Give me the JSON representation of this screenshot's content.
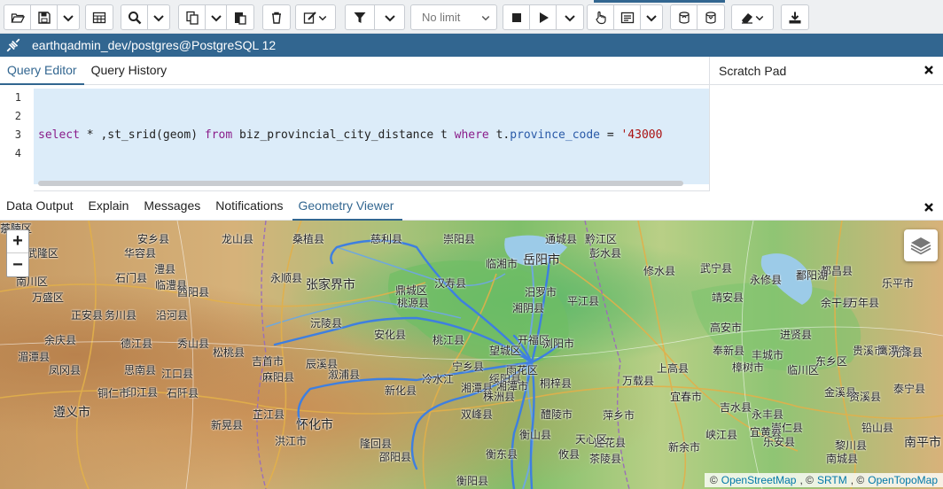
{
  "toolbar": {
    "limit_select": "No limit",
    "icons": [
      "folder-open-icon",
      "save-icon",
      "chevron-down-icon",
      "grid-icon",
      "search-icon",
      "chevron-down-icon",
      "copy-icon",
      "paste-icon",
      "delete-icon",
      "edit-icon",
      "chevron-down-icon",
      "filter-icon",
      "chevron-down-icon",
      "stop-icon",
      "play-icon",
      "chevron-down-icon",
      "hand-icon",
      "explain-icon",
      "chevron-down-icon",
      "commit-icon",
      "rollback-icon",
      "eraser-icon",
      "chevron-down-icon",
      "download-icon"
    ]
  },
  "connection": {
    "label": "earthqadmin_dev/postgres@PostgreSQL 12"
  },
  "editor_tabs": {
    "query_editor": "Query Editor",
    "query_history": "Query History"
  },
  "scratch_pad": {
    "title": "Scratch Pad"
  },
  "editor": {
    "line_numbers": [
      "1",
      "2",
      "3",
      "4"
    ],
    "line3": {
      "kw_select": "select",
      "part1": " * ,st_srid(geom) ",
      "kw_from": "from",
      "part2": " biz_provincial_city_distance t ",
      "kw_where": "where",
      "part3": " t.",
      "prop": "province_code",
      "part4": " = ",
      "str": "'43000"
    }
  },
  "result_tabs": {
    "data_output": "Data Output",
    "explain": "Explain",
    "messages": "Messages",
    "notifications": "Notifications",
    "geometry_viewer": "Geometry Viewer"
  },
  "map": {
    "zoom_in": "+",
    "zoom_out": "−",
    "attribution": {
      "prefix": "©",
      "osm": "OpenStreetMap",
      "sep1": ", ©",
      "srtm": "SRTM",
      "sep2": ", ©",
      "otm": "OpenTopoMap"
    },
    "labels": [
      {
        "text": "张家界市",
        "cls": "city"
      },
      {
        "text": "岳阳市",
        "cls": "city"
      },
      {
        "text": "怀化市",
        "cls": "city"
      },
      {
        "text": "遵义市",
        "cls": "city"
      },
      {
        "text": "南平市",
        "cls": "city"
      },
      {
        "text": "吉首市",
        "cls": ""
      },
      {
        "text": "慈利县",
        "cls": ""
      },
      {
        "text": "桑植县",
        "cls": ""
      },
      {
        "text": "永顺县",
        "cls": ""
      },
      {
        "text": "龙山县",
        "cls": ""
      },
      {
        "text": "酉阳县",
        "cls": ""
      },
      {
        "text": "秀山县",
        "cls": ""
      },
      {
        "text": "松桃县",
        "cls": ""
      },
      {
        "text": "沅陵县",
        "cls": ""
      },
      {
        "text": "安化县",
        "cls": ""
      },
      {
        "text": "桃江县",
        "cls": ""
      },
      {
        "text": "汉寿县",
        "cls": ""
      },
      {
        "text": "鼎城区",
        "cls": ""
      },
      {
        "text": "桃源县",
        "cls": ""
      },
      {
        "text": "湘阴县",
        "cls": ""
      },
      {
        "text": "汨罗市",
        "cls": ""
      },
      {
        "text": "平江县",
        "cls": ""
      },
      {
        "text": "开福区",
        "cls": ""
      },
      {
        "text": "望城区",
        "cls": ""
      },
      {
        "text": "浏阳市",
        "cls": ""
      },
      {
        "text": "宁乡县",
        "cls": ""
      },
      {
        "text": "湘潭县",
        "cls": ""
      },
      {
        "text": "醴陵市",
        "cls": ""
      },
      {
        "text": "株洲县",
        "cls": ""
      },
      {
        "text": "衡山县",
        "cls": ""
      },
      {
        "text": "双峰县",
        "cls": ""
      },
      {
        "text": "新化县",
        "cls": ""
      },
      {
        "text": "冷水江",
        "cls": ""
      },
      {
        "text": "溆浦县",
        "cls": ""
      },
      {
        "text": "辰溪县",
        "cls": ""
      },
      {
        "text": "麻阳县",
        "cls": ""
      },
      {
        "text": "芷江县",
        "cls": ""
      },
      {
        "text": "新晃县",
        "cls": ""
      },
      {
        "text": "洪江市",
        "cls": ""
      },
      {
        "text": "隆回县",
        "cls": ""
      },
      {
        "text": "邵阳县",
        "cls": ""
      },
      {
        "text": "衡阳县",
        "cls": ""
      },
      {
        "text": "衡东县",
        "cls": ""
      },
      {
        "text": "攸县",
        "cls": ""
      },
      {
        "text": "茶陵县",
        "cls": ""
      },
      {
        "text": "莲花县",
        "cls": ""
      },
      {
        "text": "萍乡市",
        "cls": ""
      },
      {
        "text": "宜春市",
        "cls": ""
      },
      {
        "text": "万载县",
        "cls": ""
      },
      {
        "text": "上高县",
        "cls": ""
      },
      {
        "text": "高安市",
        "cls": ""
      },
      {
        "text": "奉新县",
        "cls": ""
      },
      {
        "text": "靖安县",
        "cls": ""
      },
      {
        "text": "修水县",
        "cls": ""
      },
      {
        "text": "武宁县",
        "cls": ""
      },
      {
        "text": "永修县",
        "cls": ""
      },
      {
        "text": "都昌县",
        "cls": ""
      },
      {
        "text": "鄱阳湖",
        "cls": ""
      },
      {
        "text": "余干县",
        "cls": ""
      },
      {
        "text": "万年县",
        "cls": ""
      },
      {
        "text": "乐平市",
        "cls": ""
      },
      {
        "text": "进贤县",
        "cls": ""
      },
      {
        "text": "丰城市",
        "cls": ""
      },
      {
        "text": "樟树市",
        "cls": ""
      },
      {
        "text": "新余市",
        "cls": ""
      },
      {
        "text": "峡江县",
        "cls": ""
      },
      {
        "text": "吉水县",
        "cls": ""
      },
      {
        "text": "永丰县",
        "cls": ""
      },
      {
        "text": "乐安县",
        "cls": ""
      },
      {
        "text": "宜黄县",
        "cls": ""
      },
      {
        "text": "崇仁县",
        "cls": ""
      },
      {
        "text": "临川区",
        "cls": ""
      },
      {
        "text": "东乡区",
        "cls": ""
      },
      {
        "text": "金溪县",
        "cls": ""
      },
      {
        "text": "南城县",
        "cls": ""
      },
      {
        "text": "黎川县",
        "cls": ""
      },
      {
        "text": "资溪县",
        "cls": ""
      },
      {
        "text": "贵溪市",
        "cls": ""
      },
      {
        "text": "鹰潭市",
        "cls": ""
      },
      {
        "text": "铅山县",
        "cls": ""
      },
      {
        "text": "光泽县",
        "cls": ""
      },
      {
        "text": "泰宁县",
        "cls": ""
      },
      {
        "text": "石门县",
        "cls": ""
      },
      {
        "text": "临澧县",
        "cls": ""
      },
      {
        "text": "澧县",
        "cls": ""
      },
      {
        "text": "安乡县",
        "cls": ""
      },
      {
        "text": "华容县",
        "cls": ""
      },
      {
        "text": "临湘市",
        "cls": ""
      },
      {
        "text": "崇阳县",
        "cls": ""
      },
      {
        "text": "通城县",
        "cls": ""
      },
      {
        "text": "黔江区",
        "cls": ""
      },
      {
        "text": "彭水县",
        "cls": ""
      },
      {
        "text": "武隆区",
        "cls": ""
      },
      {
        "text": "南川区",
        "cls": ""
      },
      {
        "text": "万盛区",
        "cls": ""
      },
      {
        "text": "正安县",
        "cls": ""
      },
      {
        "text": "务川县",
        "cls": ""
      },
      {
        "text": "沿河县",
        "cls": ""
      },
      {
        "text": "德江县",
        "cls": ""
      },
      {
        "text": "思南县",
        "cls": ""
      },
      {
        "text": "印江县",
        "cls": ""
      },
      {
        "text": "江口县",
        "cls": ""
      },
      {
        "text": "石阡县",
        "cls": ""
      },
      {
        "text": "铜仁市",
        "cls": ""
      },
      {
        "text": "凤冈县",
        "cls": ""
      },
      {
        "text": "湄潭县",
        "cls": ""
      },
      {
        "text": "余庆县",
        "cls": ""
      },
      {
        "text": "绥阳县",
        "cls": ""
      },
      {
        "text": "桐梓县",
        "cls": ""
      },
      {
        "text": "湘潭市",
        "cls": ""
      },
      {
        "text": "雨花区",
        "cls": ""
      },
      {
        "text": "天心区",
        "cls": ""
      },
      {
        "text": "岳塘区",
        "cls": ""
      },
      {
        "text": "茶陵",
        "cls": ""
      }
    ]
  }
}
